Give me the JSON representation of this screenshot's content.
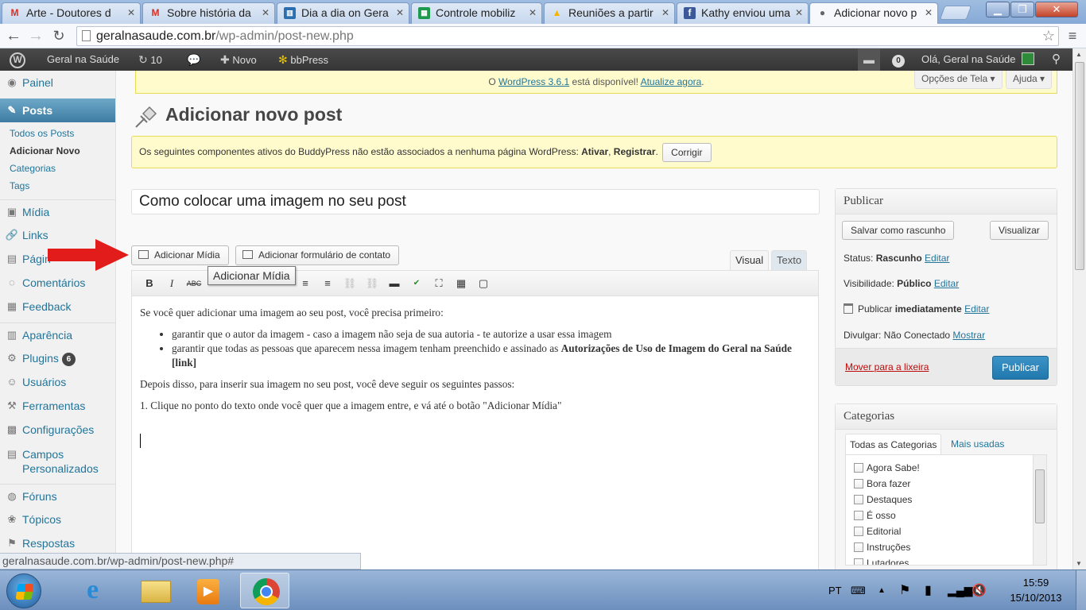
{
  "browser": {
    "tabs": [
      {
        "label": "Arte - Doutores d",
        "favicon": "gmail"
      },
      {
        "label": "Sobre história da",
        "favicon": "gmail"
      },
      {
        "label": "Dia a dia on Gera",
        "favicon": "trello"
      },
      {
        "label": "Controle mobiliz",
        "favicon": "sheets"
      },
      {
        "label": "Reuniões a partir",
        "favicon": "drive"
      },
      {
        "label": "Kathy enviou uma",
        "favicon": "facebook"
      },
      {
        "label": "Adicionar novo p",
        "favicon": "person"
      }
    ],
    "url_host": "geralnasaude.com.br",
    "url_path": "/wp-admin/post-new.php",
    "status_url": "geralnasaude.com.br/wp-admin/post-new.php#"
  },
  "adminbar": {
    "site_name": "Geral na Saúde",
    "updates": "10",
    "new_label": "Novo",
    "bbpress_label": "bbPress",
    "notifications": "0",
    "greeting": "Olá, Geral na Saúde"
  },
  "sidebar": {
    "items": [
      {
        "label": "Painel"
      },
      {
        "label": "Posts"
      },
      {
        "label": "Mídia"
      },
      {
        "label": "Links"
      },
      {
        "label": "Págin"
      },
      {
        "label": "Comentários"
      },
      {
        "label": "Feedback"
      },
      {
        "label": "Aparência"
      },
      {
        "label": "Plugins",
        "badge": "6"
      },
      {
        "label": "Usuários"
      },
      {
        "label": "Ferramentas"
      },
      {
        "label": "Configurações"
      },
      {
        "label": "Campos"
      },
      {
        "label": "Personalizados"
      },
      {
        "label": "Fóruns"
      },
      {
        "label": "Tópicos"
      },
      {
        "label": "Respostas"
      }
    ],
    "posts_sub": [
      "Todos os Posts",
      "Adicionar Novo",
      "Categorias",
      "Tags"
    ]
  },
  "notice_update": {
    "pre": "O ",
    "link": "WordPress 3.6.1",
    "mid": " está disponível! ",
    "action": "Atualize agora",
    "post": "."
  },
  "screen_options": "Opções de Tela",
  "help": "Ajuda",
  "page_title": "Adicionar novo post",
  "notice_bp": {
    "text": "Os seguintes componentes ativos do BuddyPress não estão associados a nenhuma página WordPress: ",
    "c1": "Ativar",
    "sep": ", ",
    "c2": "Registrar",
    "end": ".",
    "button": "Corrigir"
  },
  "post_title": "Como colocar uma imagem no seu post",
  "media_button": "Adicionar Mídia",
  "contact_form_button": "Adicionar formulário de contato",
  "tab_visual": "Visual",
  "tab_text": "Texto",
  "tooltip": "Adicionar Mídia",
  "content": {
    "p1": "Se você quer adicionar uma imagem ao seu post, você precisa primeiro:",
    "li1": "garantir que o autor da imagem - caso a imagem não seja de sua autoria - te autorize a usar essa imagem",
    "li2_pre": "garantir que todas as pessoas que aparecem nessa imagem tenham preenchido e assinado as ",
    "li2_bold": "Autorizações de Uso de Imagem do Geral na Saúde [link]",
    "p2": "Depois disso, para inserir sua imagem no seu post, você deve seguir os seguintes passos:",
    "p3": "1. Clique no ponto do texto onde você quer que a imagem entre, e vá até o botão \"Adicionar Mídia\""
  },
  "publish": {
    "title": "Publicar",
    "save_draft": "Salvar como rascunho",
    "preview": "Visualizar",
    "status_label": "Status: ",
    "status_value": "Rascunho",
    "visibility_label": "Visibilidade: ",
    "visibility_value": "Público",
    "publish_label": "Publicar ",
    "publish_value": "imediatamente",
    "share_label": "Divulgar: Não Conectado ",
    "share_link": "Mostrar",
    "edit": "Editar",
    "trash": "Mover para a lixeira",
    "publish_button": "Publicar"
  },
  "categories": {
    "title": "Categorias",
    "tab_all": "Todas as Categorias",
    "tab_popular": "Mais usadas",
    "items": [
      "Agora Sabe!",
      "Bora fazer",
      "Destaques",
      "É osso",
      "Editorial",
      "Instruções",
      "Lutadores"
    ]
  },
  "taskbar": {
    "lang": "PT",
    "time": "15:59",
    "date": "15/10/2013"
  },
  "colors": {
    "wp_link": "#21759b",
    "admin_menu_current": "#3f7ca3",
    "notice_bg": "#fffbcc",
    "publish_button": "#2178ad",
    "annotation_arrow": "#e21b1b"
  }
}
